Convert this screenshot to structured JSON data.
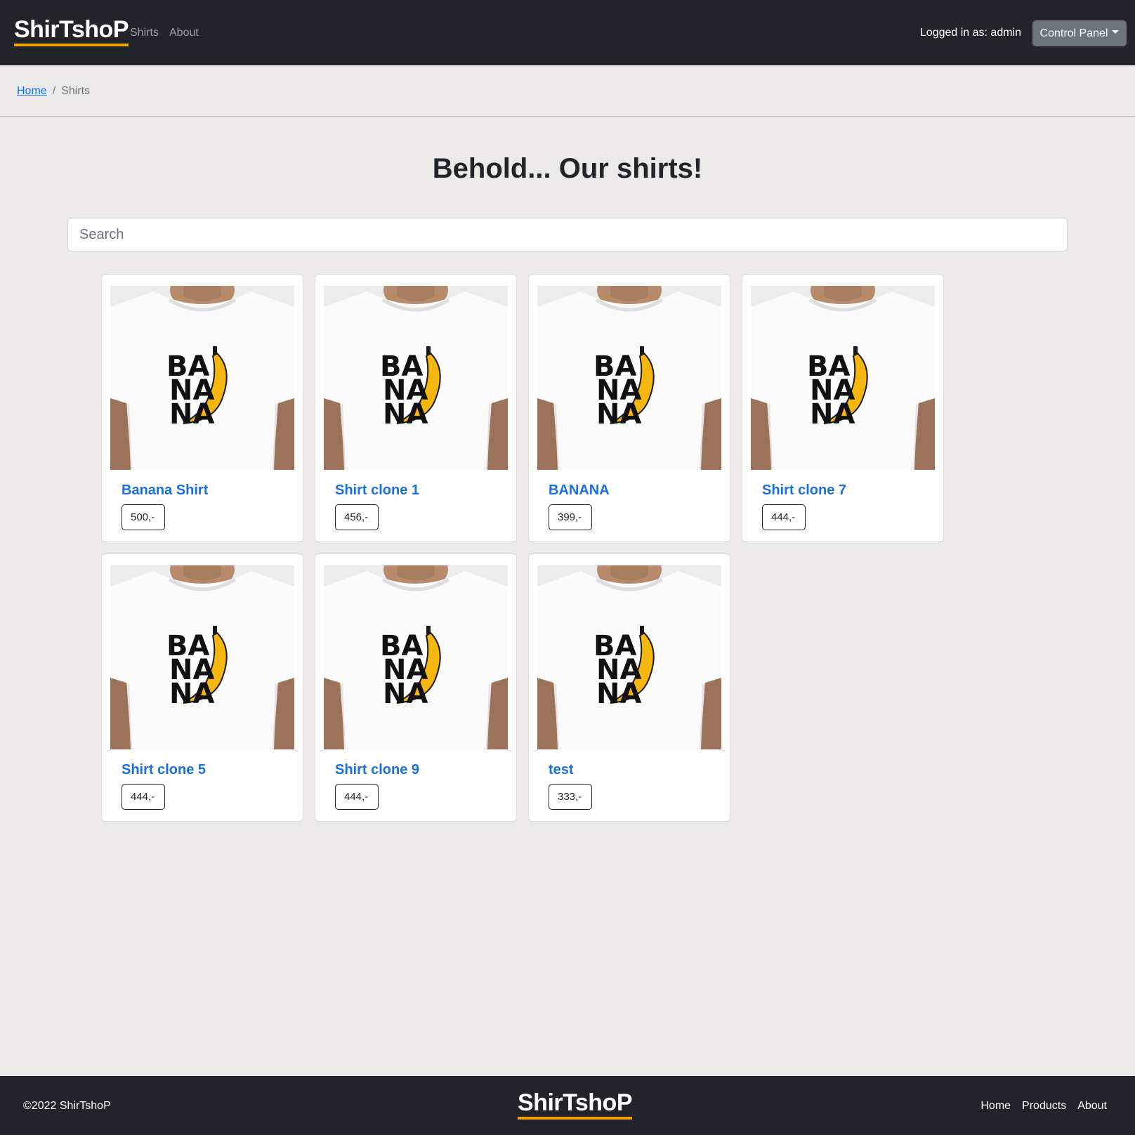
{
  "navbar": {
    "brand": "ShirTshoP",
    "links": [
      "Shirts",
      "About"
    ],
    "logged_in": "Logged in as: admin",
    "control_panel": "Control Panel"
  },
  "breadcrumb": {
    "home": "Home",
    "separator": "/",
    "current": "Shirts"
  },
  "page": {
    "heading": "Behold... Our shirts!",
    "search_placeholder": "Search"
  },
  "products": [
    {
      "name": "Banana Shirt",
      "price": "500,-"
    },
    {
      "name": "Shirt clone 1",
      "price": "456,-"
    },
    {
      "name": "BANANA",
      "price": "399,-"
    },
    {
      "name": "Shirt clone 7",
      "price": "444,-"
    },
    {
      "name": "Shirt clone 5",
      "price": "444,-"
    },
    {
      "name": "Shirt clone 9",
      "price": "444,-"
    },
    {
      "name": "test",
      "price": "333,-"
    }
  ],
  "product_image": {
    "print_lines": [
      "BA",
      "NA",
      "NA"
    ]
  },
  "footer": {
    "copyright": "©2022 ShirTshoP",
    "brand": "ShirTshoP",
    "links": [
      "Home",
      "Products",
      "About"
    ]
  },
  "colors": {
    "navbar_bg": "#212529",
    "accent": "#f0a400",
    "link": "#1a6fe0",
    "page_bg": "#ebeae8"
  }
}
